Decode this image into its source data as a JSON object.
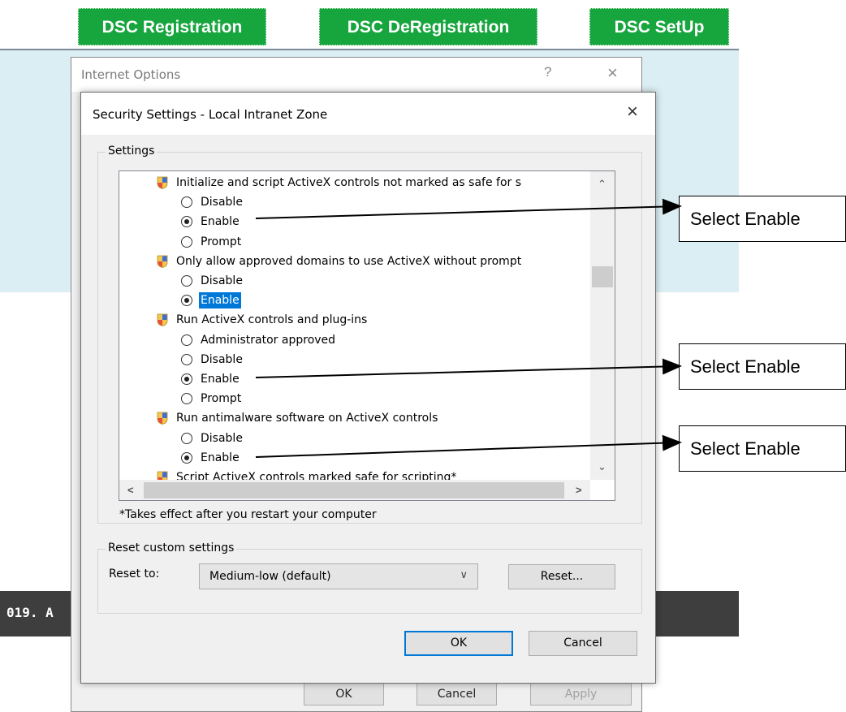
{
  "page": {
    "buttons": [
      "DSC Registration",
      "DSC DeRegistration",
      "DSC SetUp"
    ],
    "footer_text": "019. A"
  },
  "internet_options": {
    "title": "Internet Options",
    "help_glyph": "?",
    "close_glyph": "×",
    "ok": "OK",
    "cancel": "Cancel",
    "apply": "Apply"
  },
  "security_dialog": {
    "title": "Security Settings - Local Intranet Zone",
    "close_glyph": "×",
    "settings_label": "Settings",
    "items": [
      {
        "kind": "heading",
        "text": "Initialize and script ActiveX controls not marked as safe for s",
        "icon": "shield-icon"
      },
      {
        "kind": "option",
        "text": "Disable",
        "checked": false
      },
      {
        "kind": "option",
        "text": "Enable",
        "checked": true
      },
      {
        "kind": "option",
        "text": "Prompt",
        "checked": false
      },
      {
        "kind": "heading",
        "text": "Only allow approved domains to use ActiveX without prompt",
        "icon": "shield-icon"
      },
      {
        "kind": "option",
        "text": "Disable",
        "checked": false
      },
      {
        "kind": "option",
        "text": "Enable",
        "checked": true,
        "selected": true
      },
      {
        "kind": "heading",
        "text": "Run ActiveX controls and plug-ins",
        "icon": "shield-icon"
      },
      {
        "kind": "option",
        "text": "Administrator approved",
        "checked": false
      },
      {
        "kind": "option",
        "text": "Disable",
        "checked": false
      },
      {
        "kind": "option",
        "text": "Enable",
        "checked": true
      },
      {
        "kind": "option",
        "text": "Prompt",
        "checked": false
      },
      {
        "kind": "heading",
        "text": "Run antimalware software on ActiveX controls",
        "icon": "shield-icon"
      },
      {
        "kind": "option",
        "text": "Disable",
        "checked": false
      },
      {
        "kind": "option",
        "text": "Enable",
        "checked": true
      },
      {
        "kind": "heading",
        "text": "Script ActiveX controls marked safe for scripting*",
        "icon": "shield-icon"
      }
    ],
    "note": "*Takes effect after you restart your computer",
    "reset_group_label": "Reset custom settings",
    "reset_to_label": "Reset to:",
    "reset_value": "Medium-low (default)",
    "reset_button": "Reset...",
    "ok": "OK",
    "cancel": "Cancel"
  },
  "annotations": {
    "callouts": [
      "Select Enable",
      "Select Enable",
      "Select Enable"
    ]
  }
}
